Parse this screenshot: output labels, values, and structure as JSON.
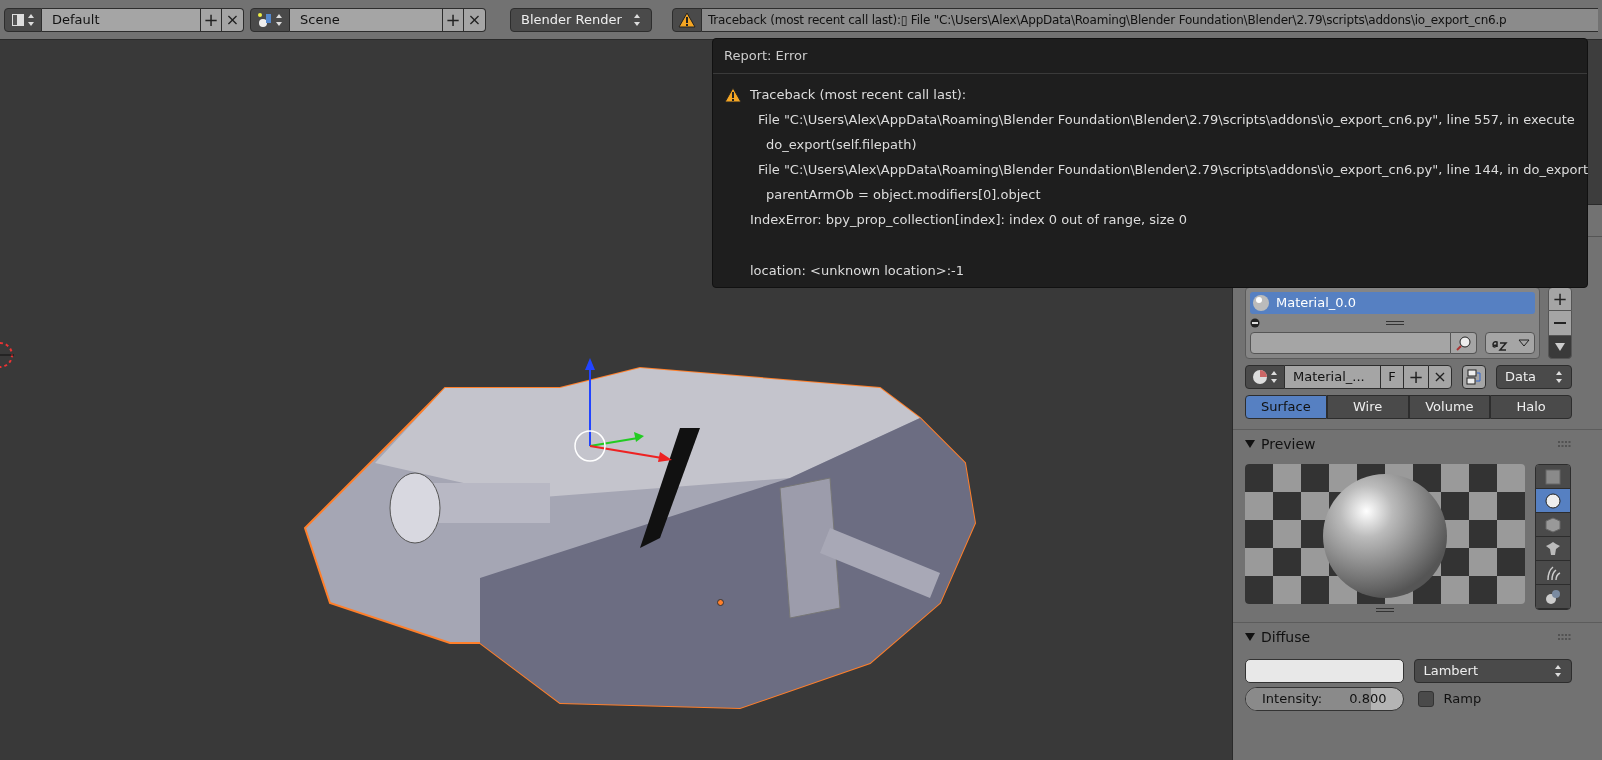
{
  "header": {
    "layout": {
      "value": "Default",
      "add": "+",
      "remove": "×"
    },
    "scene": {
      "value": "Scene",
      "add": "+",
      "remove": "×"
    },
    "render_engine": "Blender Render",
    "report": "Traceback (most recent call last):▯  File \"C:\\Users\\Alex\\AppData\\Roaming\\Blender Foundation\\Blender\\2.79\\scripts\\addons\\io_export_cn6.p"
  },
  "error_popup": {
    "title": "Report: Error",
    "lines": [
      {
        "kind": "head",
        "text": "Traceback (most recent call last):"
      },
      {
        "kind": "file",
        "text": "File \"C:\\Users\\Alex\\AppData\\Roaming\\Blender Foundation\\Blender\\2.79\\scripts\\addons\\io_export_cn6.py\", line 557, in execute"
      },
      {
        "kind": "code",
        "text": "do_export(self.filepath)"
      },
      {
        "kind": "file",
        "text": "File \"C:\\Users\\Alex\\AppData\\Roaming\\Blender Foundation\\Blender\\2.79\\scripts\\addons\\io_export_cn6.py\", line 144, in do_export"
      },
      {
        "kind": "code",
        "text": "parentArmOb = object.modifiers[0].object"
      },
      {
        "kind": "message",
        "text": "IndexError: bpy_prop_collection[index]: index 0 out of range, size 0"
      },
      {
        "kind": "location",
        "text": "location: <unknown location>:-1"
      }
    ]
  },
  "properties": {
    "material_slots": [
      {
        "name": "Material_0.0",
        "selected": true
      }
    ],
    "material_field": "Material_...",
    "fake_user": "F",
    "add": "+",
    "remove": "×",
    "link": "Data",
    "tabs": [
      {
        "label": "Surface",
        "selected": true
      },
      {
        "label": "Wire",
        "selected": false
      },
      {
        "label": "Volume",
        "selected": false
      },
      {
        "label": "Halo",
        "selected": false
      }
    ],
    "preview": {
      "title": "Preview",
      "expanded": true,
      "shapes": [
        {
          "kind": "flat",
          "selected": false
        },
        {
          "kind": "sphere",
          "selected": true
        },
        {
          "kind": "cube",
          "selected": false
        },
        {
          "kind": "monkey",
          "selected": false
        },
        {
          "kind": "hair",
          "selected": false
        },
        {
          "kind": "sky",
          "selected": false
        }
      ]
    },
    "diffuse": {
      "title": "Diffuse",
      "expanded": true,
      "shader": "Lambert",
      "intensity": {
        "label": "Intensity:",
        "reading": "0.800",
        "level": 0.8
      },
      "ramp": {
        "label": "Ramp",
        "checked": false
      }
    }
  }
}
